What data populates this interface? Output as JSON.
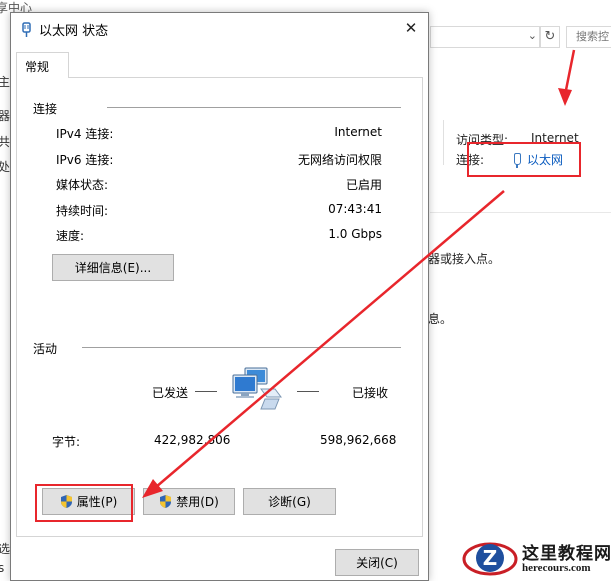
{
  "background": {
    "title_fragment": "享中心",
    "search_placeholder": "搜索控",
    "left_fragments": [
      "主",
      "器",
      "共",
      "处",
      "选",
      "s"
    ],
    "access_type_label": "访问类型:",
    "access_type_value": "Internet",
    "connections_label": "连接:",
    "connection_link": "以太网",
    "text_fragment_1": "器或接入点。",
    "text_fragment_2": "息。"
  },
  "dialog": {
    "title": "以太网 状态",
    "tab": "常规",
    "connection": {
      "header": "连接",
      "rows": [
        {
          "label": "IPv4 连接:",
          "value": "Internet"
        },
        {
          "label": "IPv6 连接:",
          "value": "无网络访问权限"
        },
        {
          "label": "媒体状态:",
          "value": "已启用"
        },
        {
          "label": "持续时间:",
          "value": "07:43:41"
        },
        {
          "label": "速度:",
          "value": "1.0 Gbps"
        }
      ],
      "details_button": "详细信息(E)..."
    },
    "activity": {
      "header": "活动",
      "sent_label": "已发送",
      "received_label": "已接收",
      "bytes_label": "字节:",
      "bytes_sent": "422,982,806",
      "bytes_received": "598,962,668"
    },
    "buttons": {
      "properties": "属性(P)",
      "disable": "禁用(D)",
      "diagnose": "诊断(G)",
      "close": "关闭(C)"
    }
  },
  "watermark": {
    "cn": "这里教程网",
    "en": "herecours.com"
  },
  "colors": {
    "annotation": "#e8262c",
    "link": "#0a5bbf",
    "button_face": "#e1e1e1"
  }
}
